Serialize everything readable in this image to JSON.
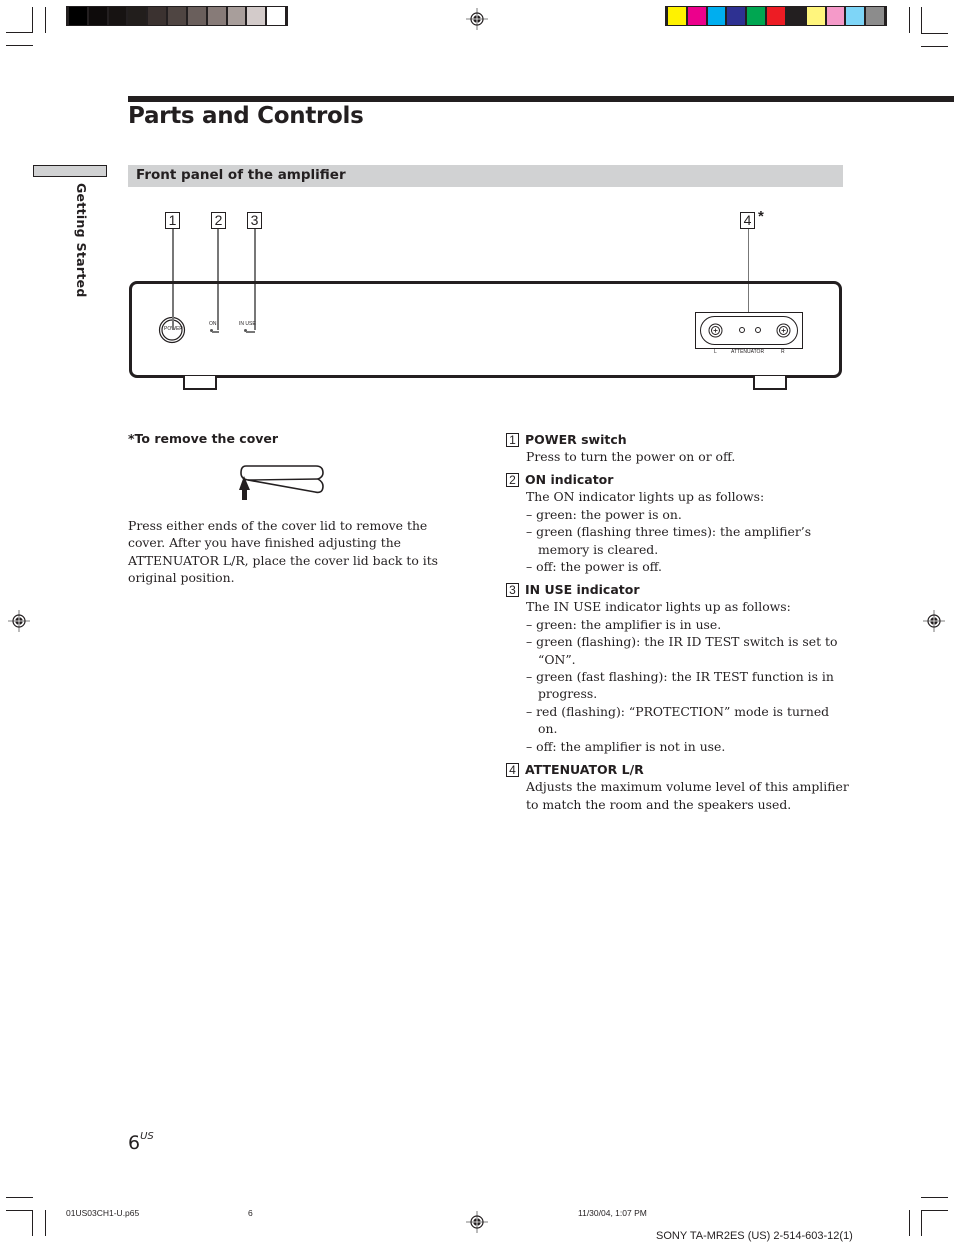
{
  "print_marks": {
    "grayscale_swatches": [
      "#000000",
      "#0e0b0b",
      "#171312",
      "#221e1c",
      "#3b3230",
      "#4f4542",
      "#6a5f5c",
      "#877b78",
      "#a89e9b",
      "#d3cbca",
      "#ffffff"
    ],
    "color_swatches": [
      "#fff200",
      "#ec008c",
      "#00aeef",
      "#2e3192",
      "#00a651",
      "#ed1c24",
      "#231f20",
      "#fff57d",
      "#f59ac9",
      "#7ed5f7",
      "#8c8c8c"
    ]
  },
  "header": {
    "title": "Parts and Controls",
    "section_title": "Front panel of the amplifier",
    "side_tab_label": "Getting Started"
  },
  "diagram": {
    "callouts": [
      "1",
      "2",
      "3",
      "4"
    ],
    "callout_4_mark": "*",
    "labels": {
      "power": "POWER",
      "on": "ON",
      "in_use": "IN USE",
      "attenuator": "ATTENUATOR",
      "left": "L",
      "right": "R"
    }
  },
  "cover_note": {
    "heading": "*To remove the cover",
    "text": "Press either ends of the cover lid to remove the cover. After you have finished adjusting the ATTENUATOR L/R, place the cover lid back to its original position."
  },
  "items": [
    {
      "number": "1",
      "title": "POWER switch",
      "description": "Press to turn the power on or off.",
      "bullets": []
    },
    {
      "number": "2",
      "title": "ON indicator",
      "description": "The ON indicator lights up as follows:",
      "bullets": [
        "– green: the power is on.",
        "– green (flashing three times): the amplifier’s memory is cleared.",
        "– off: the power is off."
      ]
    },
    {
      "number": "3",
      "title": "IN USE indicator",
      "description": "The IN USE indicator lights up as follows:",
      "bullets": [
        "– green: the amplifier is in use.",
        "– green (flashing): the IR ID TEST switch is set to “ON”.",
        "– green (fast flashing): the IR TEST function is in progress.",
        "– red (flashing): “PROTECTION” mode is turned on.",
        "– off: the amplifier is not in use."
      ]
    },
    {
      "number": "4",
      "title": "ATTENUATOR L/R",
      "description": "Adjusts the maximum volume level of this amplifier to match the room and the speakers used.",
      "bullets": []
    }
  ],
  "footer": {
    "page_number": "6",
    "page_suffix": "US",
    "file_name": "01US03CH1-U.p65",
    "file_page": "6",
    "timestamp": "11/30/04, 1:07 PM",
    "model_code": "SONY TA-MR2ES (US) 2-514-603-12(1)"
  }
}
